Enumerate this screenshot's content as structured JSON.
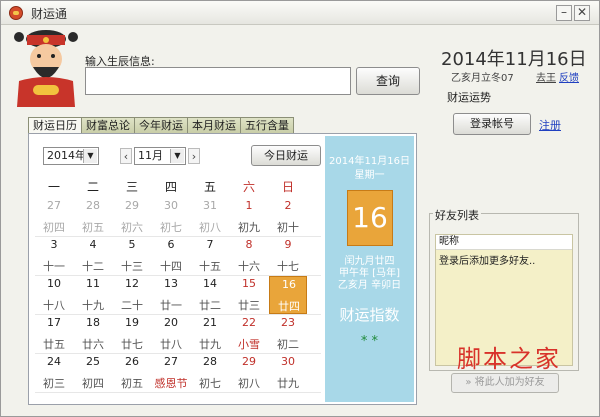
{
  "window": {
    "title": "财运通"
  },
  "input": {
    "label": "输入生辰信息:",
    "value": "",
    "placeholder": ""
  },
  "query_button": "查询",
  "header": {
    "date": "2014年11月16日",
    "lunar": "乙亥月立冬07",
    "weather_link": "去王",
    "feedback_link": "反馈",
    "fortune_label": "财运运势"
  },
  "login_button": "登录帐号",
  "register_link": "注册",
  "tabs": [
    {
      "label": "财运日历",
      "active": true
    },
    {
      "label": "财富总论",
      "active": false
    },
    {
      "label": "今年财运",
      "active": false
    },
    {
      "label": "本月财运",
      "active": false
    },
    {
      "label": "五行含量",
      "active": false
    }
  ],
  "calendar": {
    "year": "2014年",
    "month": "11月",
    "today_button": "今日财运",
    "weekdays": [
      "一",
      "二",
      "三",
      "四",
      "五",
      "六",
      "日"
    ],
    "weeks": [
      [
        {
          "d": "27",
          "l": "初四",
          "dim": true
        },
        {
          "d": "28",
          "l": "初五",
          "dim": true
        },
        {
          "d": "29",
          "l": "初六",
          "dim": true
        },
        {
          "d": "30",
          "l": "初七",
          "dim": true
        },
        {
          "d": "31",
          "l": "初八",
          "dim": true
        },
        {
          "d": "1",
          "l": "初九",
          "red": true
        },
        {
          "d": "2",
          "l": "初十",
          "red": true
        }
      ],
      [
        {
          "d": "3",
          "l": "十一"
        },
        {
          "d": "4",
          "l": "十二"
        },
        {
          "d": "5",
          "l": "十三"
        },
        {
          "d": "6",
          "l": "十四"
        },
        {
          "d": "7",
          "l": "十五"
        },
        {
          "d": "8",
          "l": "十六",
          "red": true
        },
        {
          "d": "9",
          "l": "十七",
          "red": true
        }
      ],
      [
        {
          "d": "10",
          "l": "十八"
        },
        {
          "d": "11",
          "l": "十九"
        },
        {
          "d": "12",
          "l": "二十"
        },
        {
          "d": "13",
          "l": "廿一"
        },
        {
          "d": "14",
          "l": "廿二"
        },
        {
          "d": "15",
          "l": "廿三",
          "red": true
        },
        {
          "d": "16",
          "l": "廿四",
          "red": true,
          "today": true
        }
      ],
      [
        {
          "d": "17",
          "l": "廿五"
        },
        {
          "d": "18",
          "l": "廿六"
        },
        {
          "d": "19",
          "l": "廿七"
        },
        {
          "d": "20",
          "l": "廿八"
        },
        {
          "d": "21",
          "l": "廿九"
        },
        {
          "d": "22",
          "l": "小雪",
          "red": true,
          "lred": true
        },
        {
          "d": "23",
          "l": "初二",
          "red": true
        }
      ],
      [
        {
          "d": "24",
          "l": "初三"
        },
        {
          "d": "25",
          "l": "初四"
        },
        {
          "d": "26",
          "l": "初五"
        },
        {
          "d": "27",
          "l": "感恩节",
          "lred": true
        },
        {
          "d": "28",
          "l": "初七"
        },
        {
          "d": "29",
          "l": "初八",
          "red": true
        },
        {
          "d": "30",
          "l": "廿九",
          "red": true
        }
      ]
    ]
  },
  "side": {
    "date": "2014年11月16日",
    "weekday": "星期一",
    "day": "16",
    "lunar": "闰九月廿四",
    "ganzhi_year": "甲午年 [马年]",
    "ganzhi_month": "乙亥月 辛卯日",
    "index_label": "财运指数",
    "stars": "* *"
  },
  "friends": {
    "title": "好友列表",
    "header": "昵称",
    "item": "登录后添加更多好友..",
    "add_button": "» 将此人加为好友"
  },
  "watermark": {
    "text": "脚本之家",
    "url": "www.jb51.net"
  }
}
